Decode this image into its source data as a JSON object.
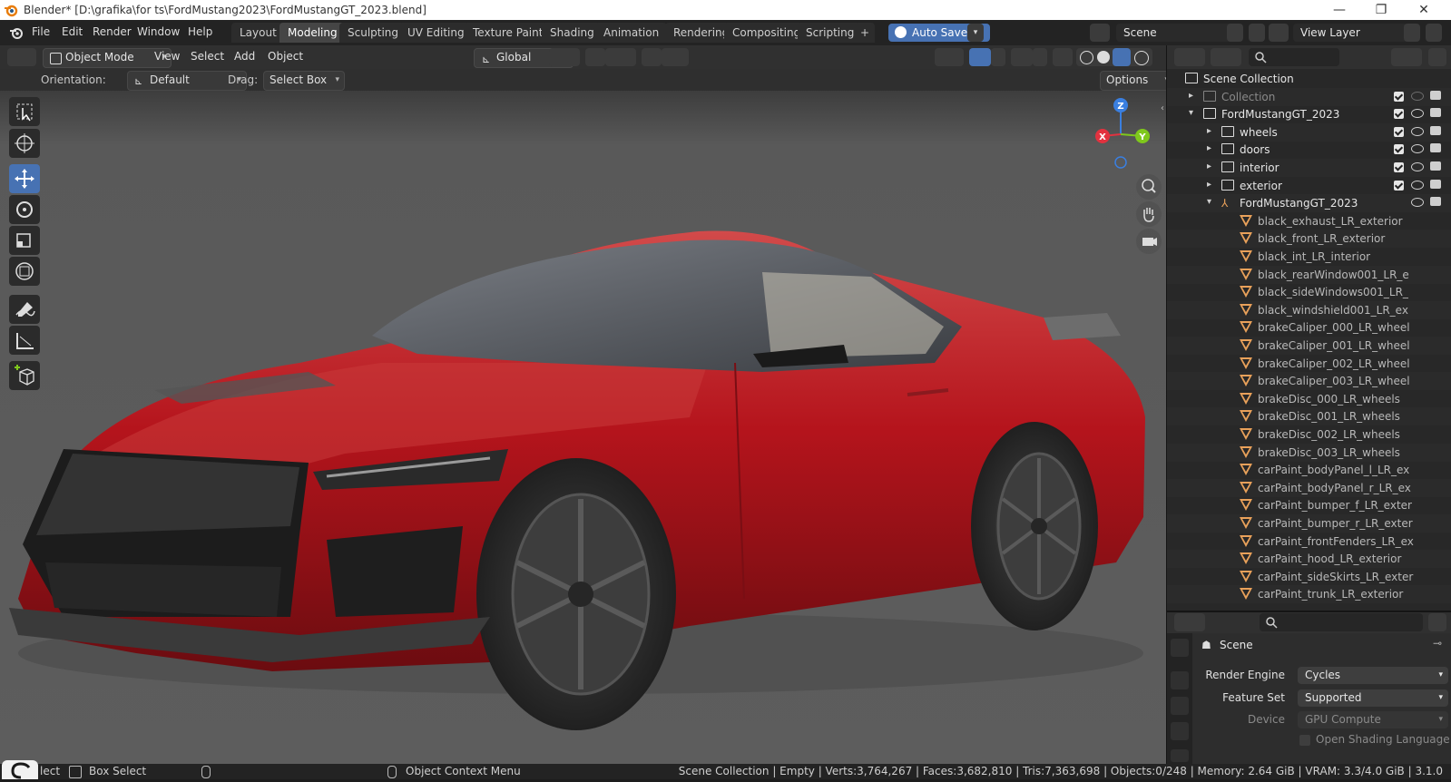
{
  "window": {
    "title": "Blender* [D:\\grafika\\for ts\\FordMustang2023\\FordMustangGT_2023.blend]",
    "minimize_glyph": "—",
    "maximize_glyph": "❐",
    "close_glyph": "✕"
  },
  "menubar": {
    "items": [
      "File",
      "Edit",
      "Render",
      "Window",
      "Help"
    ]
  },
  "workspaces": {
    "tabs": [
      "Layout",
      "Modeling",
      "Sculpting",
      "UV Editing",
      "Texture Paint",
      "Shading",
      "Animation",
      "Rendering",
      "Compositing",
      "Scripting"
    ],
    "active": "Modeling",
    "add_glyph": "+"
  },
  "autosave": {
    "label": "Auto Save"
  },
  "scene_selector": {
    "value": "Scene"
  },
  "viewlayer_selector": {
    "value": "View Layer"
  },
  "viewport_header": {
    "mode": "Object Mode",
    "menus": [
      "View",
      "Select",
      "Add",
      "Object"
    ],
    "transform_orientation": "Global"
  },
  "tool_settings": {
    "orientation_label": "Orientation:",
    "orientation_value": "Default",
    "drag_label": "Drag:",
    "drag_value": "Select Box",
    "options_label": "Options"
  },
  "gizmo": {
    "x": "X",
    "y": "Y",
    "z": "Z"
  },
  "outliner": {
    "rows": [
      {
        "label": "Scene Collection",
        "indent": 0,
        "kind": "scene",
        "expand": ""
      },
      {
        "label": "Collection",
        "indent": 1,
        "kind": "collection",
        "expand": "▸",
        "dim": true
      },
      {
        "label": "FordMustangGT_2023",
        "indent": 1,
        "kind": "collection",
        "expand": "▾"
      },
      {
        "label": "wheels",
        "indent": 2,
        "kind": "collection",
        "expand": "▸"
      },
      {
        "label": "doors",
        "indent": 2,
        "kind": "collection",
        "expand": "▸"
      },
      {
        "label": "interior",
        "indent": 2,
        "kind": "collection",
        "expand": "▸"
      },
      {
        "label": "exterior",
        "indent": 2,
        "kind": "collection",
        "expand": "▸"
      },
      {
        "label": "FordMustangGT_2023",
        "indent": 2,
        "kind": "empty",
        "expand": "▾"
      },
      {
        "label": "black_exhaust_LR_exterior",
        "indent": 3,
        "kind": "mesh",
        "expand": ""
      },
      {
        "label": "black_front_LR_exterior",
        "indent": 3,
        "kind": "mesh",
        "expand": ""
      },
      {
        "label": "black_int_LR_interior",
        "indent": 3,
        "kind": "mesh",
        "expand": ""
      },
      {
        "label": "black_rearWindow001_LR_e",
        "indent": 3,
        "kind": "mesh",
        "expand": ""
      },
      {
        "label": "black_sideWindows001_LR_",
        "indent": 3,
        "kind": "mesh",
        "expand": ""
      },
      {
        "label": "black_windshield001_LR_ex",
        "indent": 3,
        "kind": "mesh",
        "expand": ""
      },
      {
        "label": "brakeCaliper_000_LR_wheel",
        "indent": 3,
        "kind": "mesh",
        "expand": ""
      },
      {
        "label": "brakeCaliper_001_LR_wheel",
        "indent": 3,
        "kind": "mesh",
        "expand": ""
      },
      {
        "label": "brakeCaliper_002_LR_wheel",
        "indent": 3,
        "kind": "mesh",
        "expand": ""
      },
      {
        "label": "brakeCaliper_003_LR_wheel",
        "indent": 3,
        "kind": "mesh",
        "expand": ""
      },
      {
        "label": "brakeDisc_000_LR_wheels",
        "indent": 3,
        "kind": "mesh",
        "expand": ""
      },
      {
        "label": "brakeDisc_001_LR_wheels",
        "indent": 3,
        "kind": "mesh",
        "expand": ""
      },
      {
        "label": "brakeDisc_002_LR_wheels",
        "indent": 3,
        "kind": "mesh",
        "expand": ""
      },
      {
        "label": "brakeDisc_003_LR_wheels",
        "indent": 3,
        "kind": "mesh",
        "expand": ""
      },
      {
        "label": "carPaint_bodyPanel_l_LR_ex",
        "indent": 3,
        "kind": "mesh",
        "expand": ""
      },
      {
        "label": "carPaint_bodyPanel_r_LR_ex",
        "indent": 3,
        "kind": "mesh",
        "expand": ""
      },
      {
        "label": "carPaint_bumper_f_LR_exter",
        "indent": 3,
        "kind": "mesh",
        "expand": ""
      },
      {
        "label": "carPaint_bumper_r_LR_exter",
        "indent": 3,
        "kind": "mesh",
        "expand": ""
      },
      {
        "label": "carPaint_frontFenders_LR_ex",
        "indent": 3,
        "kind": "mesh",
        "expand": ""
      },
      {
        "label": "carPaint_hood_LR_exterior",
        "indent": 3,
        "kind": "mesh",
        "expand": ""
      },
      {
        "label": "carPaint_sideSkirts_LR_exter",
        "indent": 3,
        "kind": "mesh",
        "expand": ""
      },
      {
        "label": "carPaint_trunk_LR_exterior",
        "indent": 3,
        "kind": "mesh",
        "expand": ""
      }
    ]
  },
  "properties": {
    "context_title": "Scene",
    "render_engine_label": "Render Engine",
    "render_engine_value": "Cycles",
    "feature_set_label": "Feature Set",
    "feature_set_value": "Supported",
    "device_label": "Device",
    "device_value": "GPU Compute",
    "osl_label": "Open Shading Language"
  },
  "statusbar": {
    "select_label": "lect",
    "box_select_label": "Box Select",
    "context_menu_label": "Object Context Menu",
    "stats": "Scene Collection | Empty | Verts:3,764,267 | Faces:3,682,810 | Tris:7,363,698 | Objects:0/248 | Memory: 2.64 GiB | VRAM: 3.3/4.0 GiB | 3.1.0"
  },
  "colors": {
    "accent": "#4772b3",
    "car_paint": "#b5141c",
    "mesh_icon": "#e9a15a",
    "axis_x": "#e2323f",
    "axis_y": "#7fc81c",
    "axis_z": "#3a7fe0"
  }
}
